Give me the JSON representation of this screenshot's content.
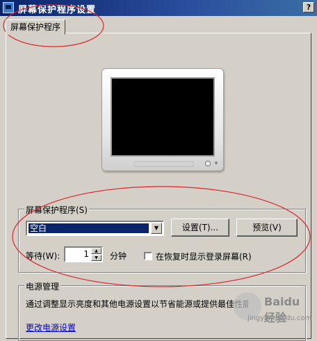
{
  "window": {
    "title": "屏幕保护程序设置",
    "help_label": "?"
  },
  "tab": {
    "label": "屏幕保护程序"
  },
  "screensaver": {
    "group_label": "屏幕保护程序(S)",
    "selected": "空白",
    "settings_button": "设置(T)...",
    "preview_button": "预览(V)",
    "wait_label": "等待(W):",
    "wait_value": "1",
    "unit_label": "分钟",
    "resume_checkbox_label": "在恢复时显示登录屏幕(R)",
    "resume_checked": false
  },
  "power": {
    "group_label": "电源管理",
    "description": "通过调整显示亮度和其他电源设置以节省能源或提供最佳性能。",
    "link_label": "更改电源设置"
  },
  "watermark": {
    "text": "Baidu 经验",
    "sub": "jingyan.baidu.com"
  },
  "annotation_color": "#d9262c"
}
